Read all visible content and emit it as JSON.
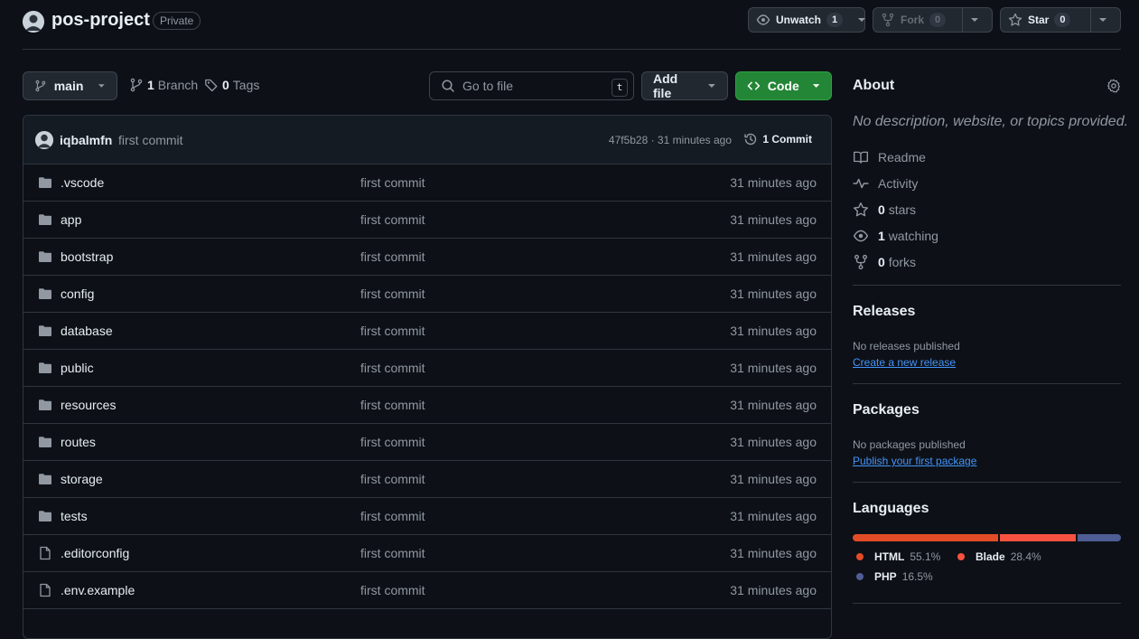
{
  "header": {
    "repo_name": "pos-project",
    "visibility": "Private",
    "unwatch_label": "Unwatch",
    "watch_count": "1",
    "fork_label": "Fork",
    "fork_count": "0",
    "star_label": "Star",
    "star_count": "0"
  },
  "toolbar": {
    "branch": "main",
    "branch_count": "1",
    "branch_label": "Branch",
    "tag_count": "0",
    "tag_label": "Tags",
    "search_placeholder": "Go to file",
    "search_key": "t",
    "add_file_label": "Add file",
    "code_label": "Code"
  },
  "commit": {
    "author": "iqbalmfn",
    "message": "first commit",
    "hash_time": "47f5b28 · 31 minutes ago",
    "count_label": "1 Commit"
  },
  "files": [
    {
      "name": ".vscode",
      "type": "folder",
      "message": "first commit",
      "age": "31 minutes ago"
    },
    {
      "name": "app",
      "type": "folder",
      "message": "first commit",
      "age": "31 minutes ago"
    },
    {
      "name": "bootstrap",
      "type": "folder",
      "message": "first commit",
      "age": "31 minutes ago"
    },
    {
      "name": "config",
      "type": "folder",
      "message": "first commit",
      "age": "31 minutes ago"
    },
    {
      "name": "database",
      "type": "folder",
      "message": "first commit",
      "age": "31 minutes ago"
    },
    {
      "name": "public",
      "type": "folder",
      "message": "first commit",
      "age": "31 minutes ago"
    },
    {
      "name": "resources",
      "type": "folder",
      "message": "first commit",
      "age": "31 minutes ago"
    },
    {
      "name": "routes",
      "type": "folder",
      "message": "first commit",
      "age": "31 minutes ago"
    },
    {
      "name": "storage",
      "type": "folder",
      "message": "first commit",
      "age": "31 minutes ago"
    },
    {
      "name": "tests",
      "type": "folder",
      "message": "first commit",
      "age": "31 minutes ago"
    },
    {
      "name": ".editorconfig",
      "type": "file",
      "message": "first commit",
      "age": "31 minutes ago"
    },
    {
      "name": ".env.example",
      "type": "file",
      "message": "first commit",
      "age": "31 minutes ago"
    }
  ],
  "about": {
    "title": "About",
    "description": "No description, website, or topics provided.",
    "readme": "Readme",
    "activity": "Activity",
    "stars_count": "0",
    "stars_label": "stars",
    "watching_count": "1",
    "watching_label": "watching",
    "forks_count": "0",
    "forks_label": "forks"
  },
  "releases": {
    "title": "Releases",
    "empty": "No releases published",
    "link": "Create a new release"
  },
  "packages": {
    "title": "Packages",
    "empty": "No packages published",
    "link": "Publish your first package"
  },
  "languages": {
    "title": "Languages",
    "items": [
      {
        "name": "HTML",
        "percent": "55.1%",
        "value": 55.1,
        "color": "#e34c26"
      },
      {
        "name": "Blade",
        "percent": "28.4%",
        "value": 28.4,
        "color": "#f7523f"
      },
      {
        "name": "PHP",
        "percent": "16.5%",
        "value": 16.5,
        "color": "#4f5d95"
      }
    ]
  },
  "colors": {
    "background": "#0d1117",
    "accent_green": "#238636",
    "link": "#4493f8"
  }
}
